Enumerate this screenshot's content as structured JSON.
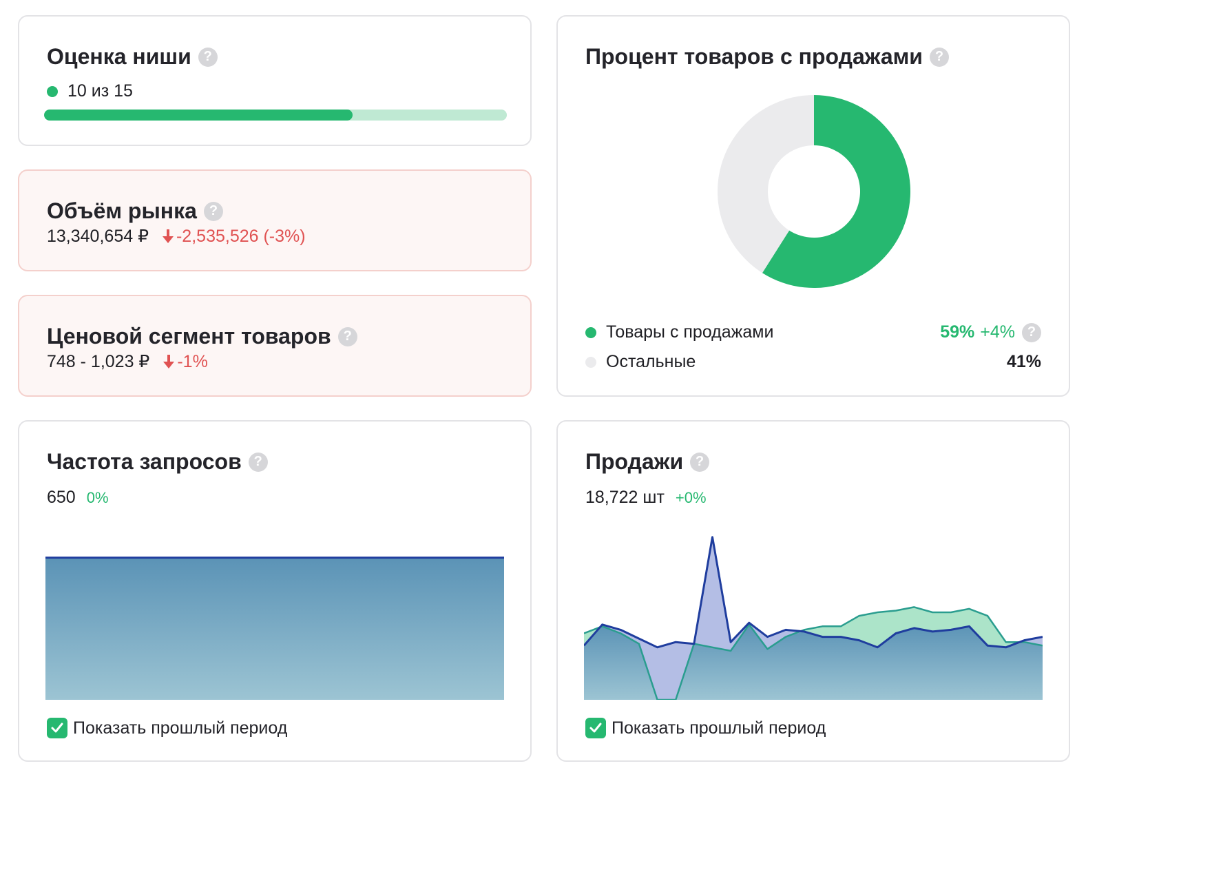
{
  "niche_score": {
    "title": "Оценка ниши",
    "value_text": "10 из 15",
    "progress": 0.6667,
    "color": "#26b870"
  },
  "market_volume": {
    "title": "Объём рынка",
    "value": "13,340,654 ₽",
    "change": "-2,535,526 (-3%)"
  },
  "price_segment": {
    "title": "Ценовой сегмент товаров",
    "value": "748 - 1,023 ₽",
    "change": "-1%"
  },
  "sales_percent": {
    "title": "Процент товаров с продажами",
    "legend": [
      {
        "label": "Товары с продажами",
        "value": "59%",
        "delta": "+4%",
        "color": "#26b870"
      },
      {
        "label": "Остальные",
        "value": "41%",
        "color": "#ebebed"
      }
    ]
  },
  "query_frequency": {
    "title": "Частота запросов",
    "value": "650",
    "delta": "0%",
    "checkbox_label": "Показать прошлый период"
  },
  "sales": {
    "title": "Продажи",
    "value": "18,722 шт",
    "delta": "+0%",
    "checkbox_label": "Показать прошлый период"
  },
  "chart_data": [
    {
      "type": "pie",
      "categories": [
        "Товары с продажами",
        "Остальные"
      ],
      "values": [
        59,
        41
      ],
      "colors": [
        "#26b870",
        "#ebebed"
      ]
    },
    {
      "type": "area",
      "series": [
        {
          "values": [
            650,
            650,
            650,
            650,
            650,
            650,
            650,
            650,
            650,
            650,
            650,
            650,
            650,
            650,
            650,
            650,
            650,
            650,
            650,
            650,
            650,
            650,
            650,
            650,
            650
          ],
          "color": "#1f3d9e"
        }
      ],
      "ylim": [
        0,
        800
      ]
    },
    {
      "type": "area",
      "series": [
        {
          "values": [
            38,
            42,
            38,
            32,
            0,
            0,
            32,
            30,
            28,
            43,
            29,
            36,
            40,
            42,
            42,
            48,
            50,
            51,
            53,
            50,
            50,
            52,
            48,
            33,
            33,
            31
          ],
          "color": "#26b870"
        },
        {
          "values": [
            31,
            43,
            40,
            35,
            30,
            33,
            32,
            93,
            33,
            44,
            36,
            40,
            39,
            36,
            36,
            34,
            30,
            38,
            41,
            39,
            40,
            42,
            31,
            30,
            34,
            36
          ],
          "color": "#1f3d9e"
        }
      ],
      "ylim": [
        0,
        100
      ]
    }
  ]
}
